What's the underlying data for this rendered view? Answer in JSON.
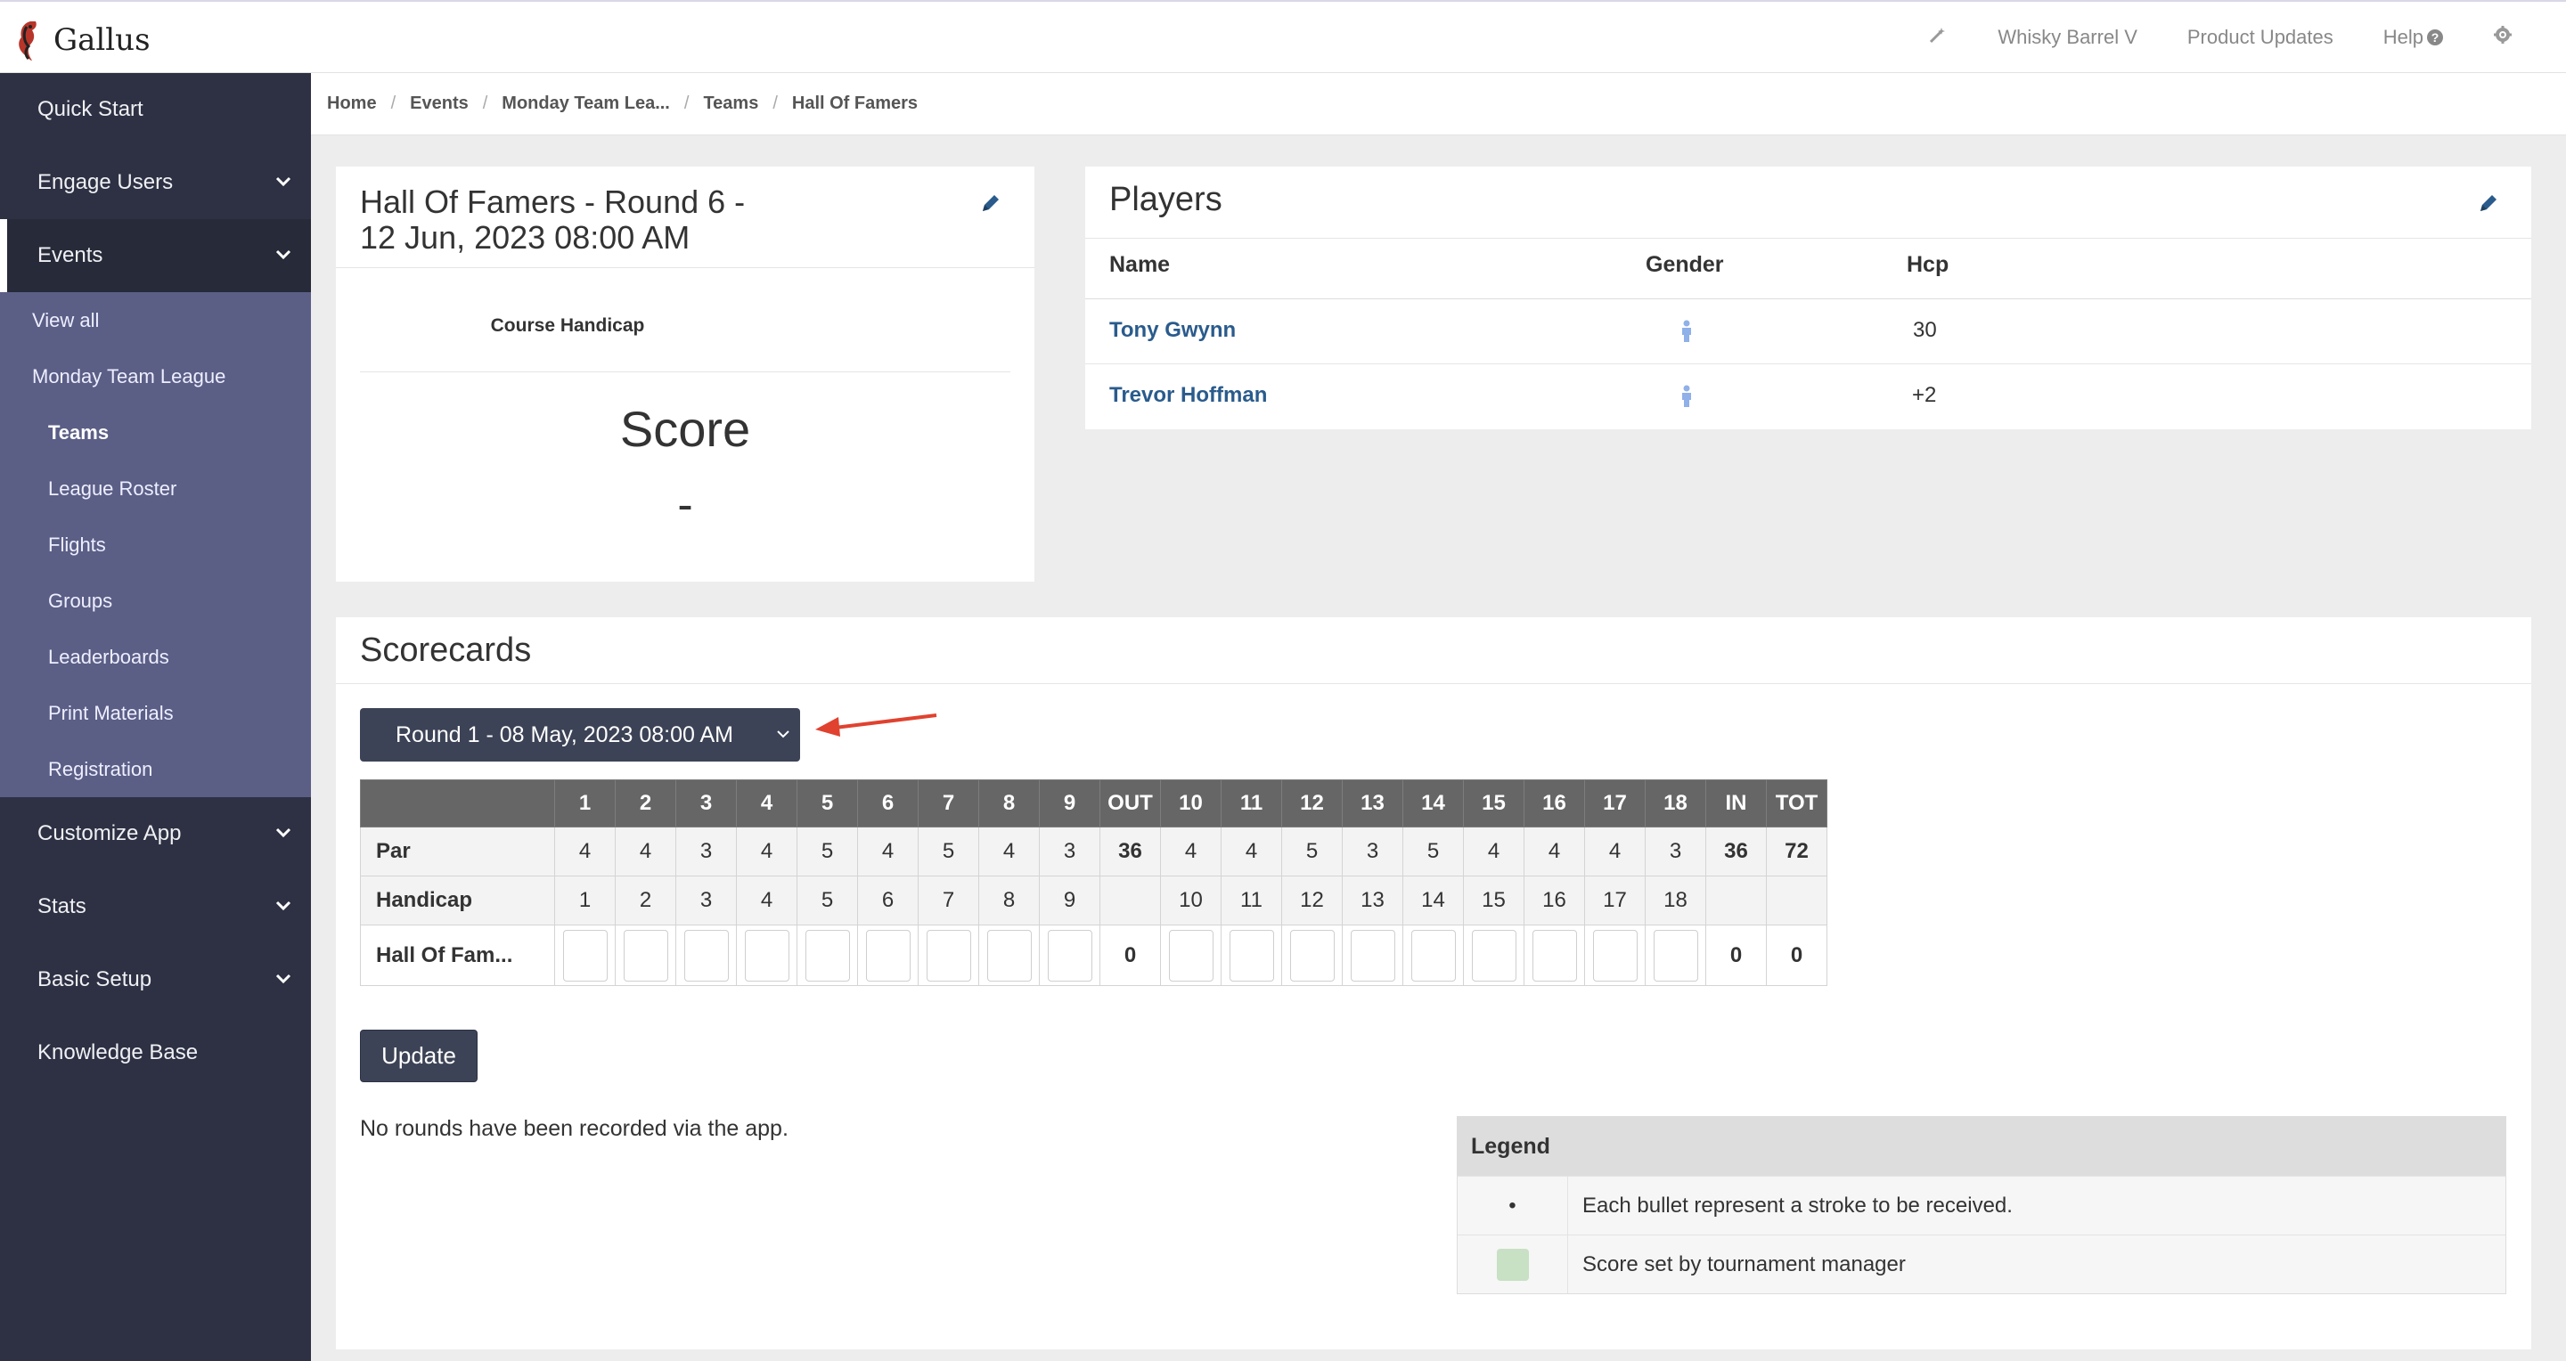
{
  "app": {
    "name": "Gallus"
  },
  "topbar": {
    "account": "Whisky Barrel V",
    "product_updates": "Product Updates",
    "help": "Help"
  },
  "sidebar": {
    "quick_start": "Quick Start",
    "engage_users": "Engage Users",
    "events": "Events",
    "events_sub": {
      "view_all": "View all",
      "league": "Monday Team League",
      "teams": "Teams",
      "league_roster": "League Roster",
      "flights": "Flights",
      "groups": "Groups",
      "leaderboards": "Leaderboards",
      "print_materials": "Print Materials",
      "registration": "Registration"
    },
    "customize_app": "Customize App",
    "stats": "Stats",
    "basic_setup": "Basic Setup",
    "knowledge_base": "Knowledge Base"
  },
  "breadcrumb": [
    "Home",
    "Events",
    "Monday Team Lea...",
    "Teams",
    "Hall Of Famers"
  ],
  "team_card": {
    "title_line1": "Hall Of Famers - Round 6 -",
    "title_line2": "12 Jun, 2023 08:00 AM",
    "course_handicap_label": "Course Handicap",
    "score_label": "Score",
    "score_value": "-"
  },
  "players": {
    "title": "Players",
    "headers": {
      "name": "Name",
      "gender": "Gender",
      "hcp": "Hcp"
    },
    "rows": [
      {
        "name": "Tony Gwynn",
        "hcp": "30"
      },
      {
        "name": "Trevor Hoffman",
        "hcp": "+2"
      }
    ]
  },
  "scorecards": {
    "title": "Scorecards",
    "round_select": "Round 1 - 08 May, 2023 08:00 AM",
    "headers": [
      "1",
      "2",
      "3",
      "4",
      "5",
      "6",
      "7",
      "8",
      "9",
      "OUT",
      "10",
      "11",
      "12",
      "13",
      "14",
      "15",
      "16",
      "17",
      "18",
      "IN",
      "TOT"
    ],
    "par_label": "Par",
    "par": [
      "4",
      "4",
      "3",
      "4",
      "5",
      "4",
      "5",
      "4",
      "3",
      "36",
      "4",
      "4",
      "5",
      "3",
      "5",
      "4",
      "4",
      "4",
      "3",
      "36",
      "72"
    ],
    "handicap_label": "Handicap",
    "handicap": [
      "1",
      "2",
      "3",
      "4",
      "5",
      "6",
      "7",
      "8",
      "9",
      "",
      "10",
      "11",
      "12",
      "13",
      "14",
      "15",
      "16",
      "17",
      "18",
      "",
      ""
    ],
    "team_label": "Hall Of Fam...",
    "team_out": "0",
    "team_in": "0",
    "team_tot": "0",
    "update_button": "Update",
    "no_rounds": "No rounds have been recorded via the app."
  },
  "legend": {
    "title": "Legend",
    "bullet_symbol": "•",
    "bullet_text": "Each bullet represent a stroke to be received.",
    "green_text": "Score set by tournament manager"
  },
  "colors": {
    "sidebar": "#2d3143",
    "sidebar_sub": "#5b5f86",
    "accent_button": "#3d4356",
    "link": "#2a5b8c",
    "annotation_arrow": "#e0422f"
  }
}
